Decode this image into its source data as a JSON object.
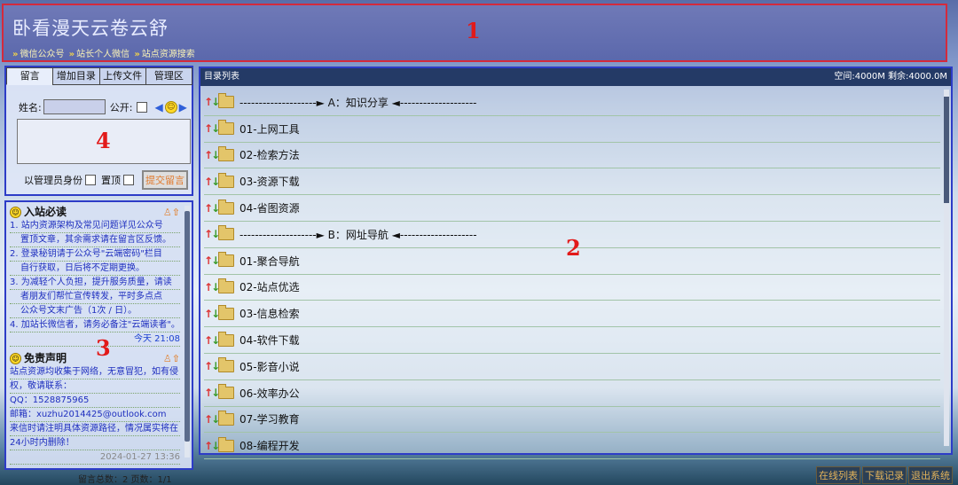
{
  "annotations": [
    "1",
    "2",
    "3",
    "4"
  ],
  "header": {
    "title": "卧看漫天云卷云舒",
    "nav": [
      "微信公众号",
      "站长个人微信",
      "站点资源搜索"
    ]
  },
  "message_panel": {
    "tabs": [
      "留言",
      "增加目录",
      "上传文件",
      "管理区"
    ],
    "name_label": "姓名:",
    "public_label": "公开:",
    "admin_label": "以管理员身份",
    "top_label": "置顶",
    "submit_label": "提交留言"
  },
  "notice": {
    "first_title": "入站必读",
    "first_lines": [
      "1. 站内资源架构及常见问题详见公众号",
      "置顶文章，其余需求请在留言区反馈。",
      "2. 登录秘钥请于公众号\"云端密码\"栏目",
      "自行获取，日后将不定期更换。",
      "3. 为减轻个人负担，提升服务质量，请读",
      "者朋友们帮忙宣传转发，平时多点点",
      "公众号文末广告（1次 / 日）。",
      "4. 加站长微信者，请务必备注\"云端读者\"。"
    ],
    "first_time": "今天 21:08",
    "second_title": "免责声明",
    "second_lines": [
      "站点资源均收集于网络，无意冒犯，如有侵",
      "权，敬请联系：",
      "QQ：1528875965",
      "邮箱：xuzhu2014425@outlook.com",
      "来信时请注明具体资源路径，情况属实将在",
      "24小时内删除！"
    ],
    "second_time": "2024-01-27 13:36",
    "footer": "留言总数：2   页数：1/1"
  },
  "directory": {
    "header_label": "目录列表",
    "space": "空间:4000M 剩余:4000.0M",
    "rows": [
      "--------------------► A：知识分享 ◄--------------------",
      "01-上网工具",
      "02-检索方法",
      "03-资源下载",
      "04-省图资源",
      "--------------------► B：网址导航 ◄--------------------",
      "01-聚合导航",
      "02-站点优选",
      "03-信息检索",
      "04-软件下载",
      "05-影音小说",
      "06-效率办公",
      "07-学习教育",
      "08-编程开发"
    ]
  },
  "bottom_buttons": [
    "在线列表",
    "下载记录",
    "退出系统"
  ]
}
